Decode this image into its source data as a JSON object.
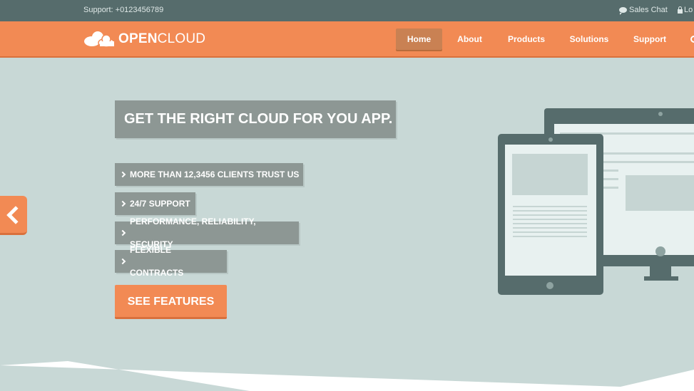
{
  "topbar": {
    "support": "Support: +0123456789",
    "sales_chat": "Sales Chat",
    "login": "Lo",
    "chat_icon": "chat-bubble-icon",
    "lock_icon": "lock-icon"
  },
  "logo": {
    "open": "OPEN",
    "cloud": "CLOUD",
    "icon": "cloud-icon"
  },
  "nav": {
    "items": [
      {
        "label": "Home",
        "active": true
      },
      {
        "label": "About",
        "active": false
      },
      {
        "label": "Products",
        "active": false
      },
      {
        "label": "Solutions",
        "active": false
      },
      {
        "label": "Support",
        "active": false
      }
    ]
  },
  "hero": {
    "headline": "GET THE RIGHT CLOUD FOR YOU APP.",
    "features": [
      "MORE THAN 12,3456 CLIENTS TRUST US",
      "24/7 SUPPORT",
      "PERFORMANCE, RELIABILITY, SECURITY",
      "FLEXIBLE CONTRACTS"
    ],
    "cta": "SEE FEATURES",
    "prev_icon": "chevron-left-icon"
  },
  "colors": {
    "topbar": "#566c6c",
    "accent": "#f28a54",
    "hero_bg": "#c8d8d6",
    "label_bg": "#8d9794"
  }
}
